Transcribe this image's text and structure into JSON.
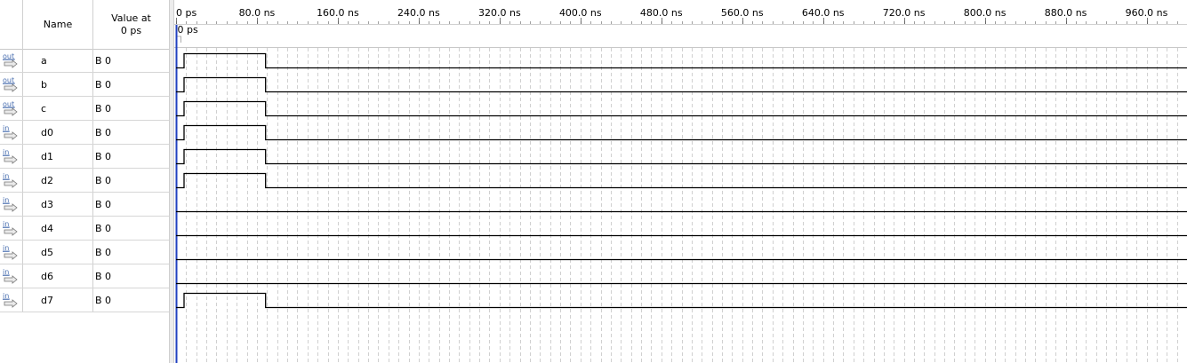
{
  "header": {
    "name_label": "Name",
    "value_label_line1": "Value at",
    "value_label_line2": "0 ps"
  },
  "signals": [
    {
      "direction": "out",
      "name": "a",
      "value": "B 0",
      "pulses": [
        [
          0,
          100
        ]
      ]
    },
    {
      "direction": "out",
      "name": "b",
      "value": "B 0",
      "pulses": [
        [
          0,
          100
        ]
      ]
    },
    {
      "direction": "out",
      "name": "c",
      "value": "B 0",
      "pulses": [
        [
          0,
          100
        ]
      ]
    },
    {
      "direction": "in",
      "name": "d0",
      "value": "B 0",
      "pulses": [
        [
          0,
          100
        ]
      ]
    },
    {
      "direction": "in",
      "name": "d1",
      "value": "B 0",
      "pulses": [
        [
          0,
          100
        ]
      ]
    },
    {
      "direction": "in",
      "name": "d2",
      "value": "B 0",
      "pulses": [
        [
          0,
          100
        ]
      ]
    },
    {
      "direction": "in",
      "name": "d3",
      "value": "B 0",
      "pulses": []
    },
    {
      "direction": "in",
      "name": "d4",
      "value": "B 0",
      "pulses": []
    },
    {
      "direction": "in",
      "name": "d5",
      "value": "B 0",
      "pulses": []
    },
    {
      "direction": "in",
      "name": "d6",
      "value": "B 0",
      "pulses": []
    },
    {
      "direction": "in",
      "name": "d7",
      "value": "B 0",
      "pulses": [
        [
          0,
          100
        ]
      ]
    }
  ],
  "timeline": {
    "unit": "ns",
    "range": [
      0,
      1000
    ],
    "ticks": [
      {
        "t": 0,
        "label": "0 ps"
      },
      {
        "t": 80,
        "label": "80.0 ns"
      },
      {
        "t": 160,
        "label": "160.0 ns"
      },
      {
        "t": 240,
        "label": "240.0 ns"
      },
      {
        "t": 320,
        "label": "320.0 ns"
      },
      {
        "t": 400,
        "label": "400.0 ns"
      },
      {
        "t": 480,
        "label": "480.0 ns"
      },
      {
        "t": 560,
        "label": "560.0 ns"
      },
      {
        "t": 640,
        "label": "640.0 ns"
      },
      {
        "t": 720,
        "label": "720.0 ns"
      },
      {
        "t": 800,
        "label": "800.0 ns"
      },
      {
        "t": 880,
        "label": "880.0 ns"
      },
      {
        "t": 960,
        "label": "960.0 ns"
      }
    ],
    "cursor_label": "0 ps",
    "cursor_time": 0
  },
  "colors": {
    "in_icon": "#4a6fb0",
    "out_icon": "#4a6fb0",
    "cursor": "#2040c0",
    "grid": "#bcbcbc",
    "wave": "#000000"
  }
}
